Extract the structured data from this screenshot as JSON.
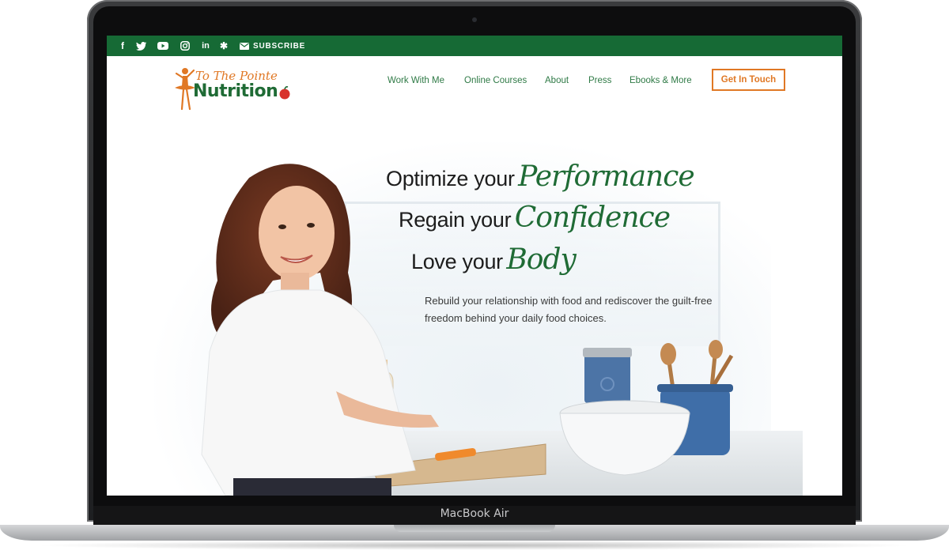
{
  "topbar": {
    "color": "#166a35",
    "social_icons": [
      {
        "name": "facebook-icon",
        "glyph": "f"
      },
      {
        "name": "twitter-icon",
        "glyph": "t"
      },
      {
        "name": "youtube-icon",
        "glyph": "▶"
      },
      {
        "name": "instagram-icon",
        "glyph": "◎"
      },
      {
        "name": "linkedin-icon",
        "glyph": "in"
      },
      {
        "name": "yelp-icon",
        "glyph": "✱"
      }
    ],
    "subscribe_label": "SUBSCRIBE"
  },
  "logo": {
    "script_text": "To The Pointe",
    "wordmark": "Nutrition"
  },
  "nav": {
    "items": [
      "Work With Me",
      "Online Courses",
      "About",
      "Press",
      "Ebooks & More"
    ],
    "cta_label": "Get In Touch",
    "accent": "#e07825"
  },
  "hero": {
    "lines": [
      {
        "plain": "Optimize your",
        "script": "Performance"
      },
      {
        "plain": "Regain your",
        "script": "Confidence"
      },
      {
        "plain": "Love your",
        "script": "Body"
      }
    ],
    "tagline_1": "Rebuild your relationship with food and rediscover the guilt-free",
    "tagline_2": "freedom behind your daily food choices."
  },
  "device": {
    "label": "MacBook Air"
  }
}
